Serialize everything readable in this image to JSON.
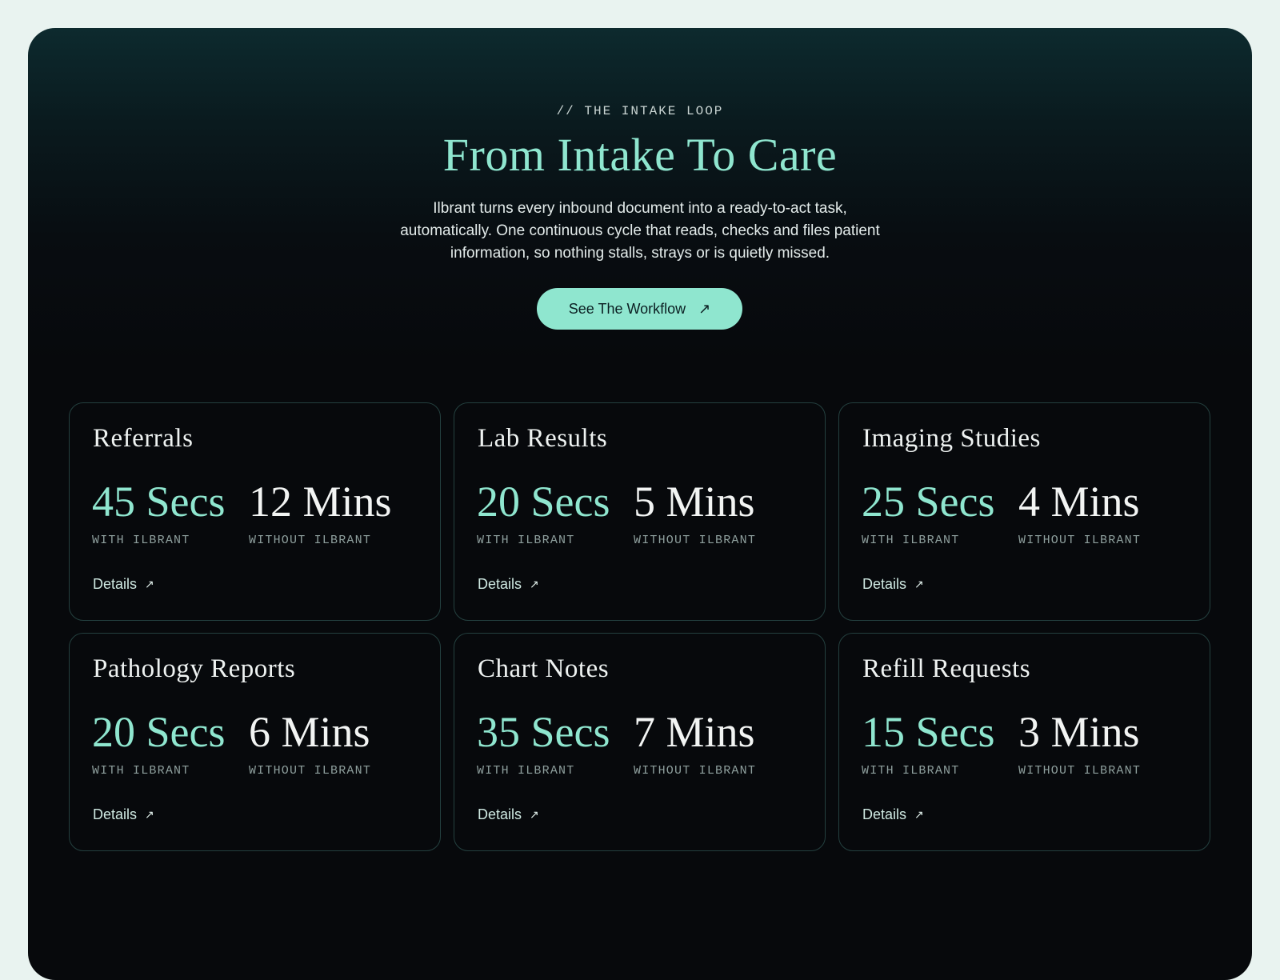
{
  "hero": {
    "eyebrow": "// THE INTAKE LOOP",
    "title": "From Intake To Care",
    "subtitle": "Ilbrant turns every inbound document into a ready-to-act task, automatically. One continuous cycle that reads, checks and files patient information, so nothing stalls, strays or is quietly missed.",
    "cta_label": "See The Workflow",
    "cta_icon": "arrow-up-right-icon"
  },
  "colors": {
    "accent": "#8fe6cf",
    "background": "#e9f3f0",
    "panel": "#07090c",
    "card_border": "#24403f"
  },
  "cards": [
    {
      "title": "Referrals",
      "with_value": "45 Secs",
      "with_label": "WITH ILBRANT",
      "without_value": "12 Mins",
      "without_label": "WITHOUT ILBRANT",
      "details_label": "Details"
    },
    {
      "title": "Lab Results",
      "with_value": "20 Secs",
      "with_label": "WITH ILBRANT",
      "without_value": "5 Mins",
      "without_label": "WITHOUT ILBRANT",
      "details_label": "Details"
    },
    {
      "title": "Imaging Studies",
      "with_value": "25 Secs",
      "with_label": "WITH ILBRANT",
      "without_value": "4 Mins",
      "without_label": "WITHOUT ILBRANT",
      "details_label": "Details"
    },
    {
      "title": "Pathology Reports",
      "with_value": "20 Secs",
      "with_label": "WITH ILBRANT",
      "without_value": "6 Mins",
      "without_label": "WITHOUT ILBRANT",
      "details_label": "Details"
    },
    {
      "title": "Chart Notes",
      "with_value": "35 Secs",
      "with_label": "WITH ILBRANT",
      "without_value": "7 Mins",
      "without_label": "WITHOUT ILBRANT",
      "details_label": "Details"
    },
    {
      "title": "Refill Requests",
      "with_value": "15 Secs",
      "with_label": "WITH ILBRANT",
      "without_value": "3 Mins",
      "without_label": "WITHOUT ILBRANT",
      "details_label": "Details"
    }
  ]
}
